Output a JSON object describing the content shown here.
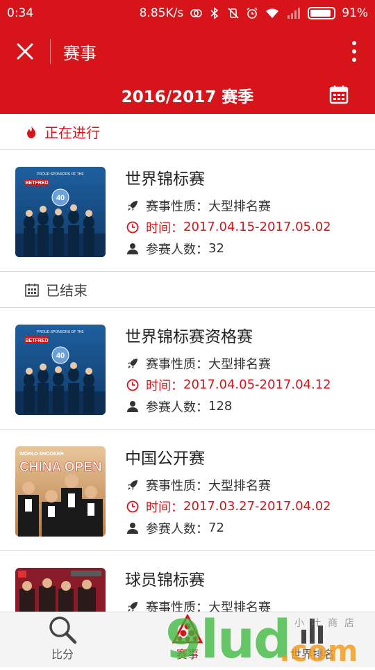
{
  "status_bar": {
    "time": "0:34",
    "network_speed": "8.85K/s",
    "battery": "91%",
    "battery_level": 0.91
  },
  "appbar": {
    "title": "赛事"
  },
  "season": {
    "title": "2016/2017 赛季"
  },
  "sections": [
    {
      "label": "正在进行",
      "icon": "fire-icon"
    },
    {
      "label": "已结束",
      "icon": "calendar-grid-icon"
    }
  ],
  "labels": {
    "type_prefix": "赛事性质：",
    "time_prefix": "时间：",
    "players_prefix": "参赛人数："
  },
  "events": [
    {
      "name": "世界锦标赛",
      "type": "大型排名赛",
      "time": "2017.04.15-2017.05.02",
      "players": "32",
      "poster_text": "PROUD SPONSORS OF THE",
      "poster_brand": "BETFRED",
      "poster_number": "40"
    },
    {
      "name": "世界锦标赛资格赛",
      "type": "大型排名赛",
      "time": "2017.04.05-2017.04.12",
      "players": "128",
      "poster_text": "PROUD SPONSORS OF THE",
      "poster_brand": "BETFRED",
      "poster_number": "40"
    },
    {
      "name": "中国公开赛",
      "type": "大型排名赛",
      "time": "2017.03.27-2017.04.02",
      "players": "72",
      "poster_top": "WORLD SNOOKER",
      "poster_main": "CHINA OPEN"
    },
    {
      "name": "球员锦标赛",
      "type": "大型排名赛",
      "time": "",
      "players": ""
    }
  ],
  "tabs": [
    {
      "label": "比分",
      "icon": "search-icon"
    },
    {
      "label": "赛事",
      "icon": "snooker-balls-icon"
    },
    {
      "label": "世界排名",
      "icon": "bar-chart-icon"
    }
  ],
  "watermark": {
    "main": "9lud",
    "suffix": ".com",
    "shop": "小叶商店"
  },
  "colors": {
    "brand_red": "#d8141b",
    "divider": "#d9d9d9",
    "tab_bg": "#f4f4f4"
  }
}
